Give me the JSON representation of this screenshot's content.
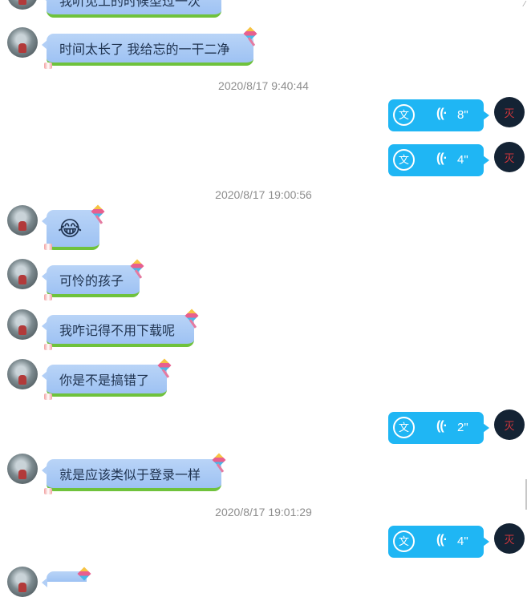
{
  "messages": {
    "m1_text": "我听见工的时候型过一次",
    "m2_text": "时间太长了 我给忘的一干二净",
    "m4_emoji": "😂",
    "m5_text": "可怜的孩子",
    "m6_text": "我咋记得不用下载呢",
    "m7_text": "你是不是搞错了",
    "m8_text": "就是应该类似于登录一样"
  },
  "timestamps": {
    "t1": "2020/8/17 9:40:44",
    "t2": "2020/8/17 19:00:56",
    "t3": "2020/8/17 19:01:29"
  },
  "voice": {
    "translate_glyph": "文",
    "wave_glyph": "((·",
    "v1": "8\"",
    "v2": "4\"",
    "v3": "2\"",
    "v4": "4\""
  },
  "self_avatar_glyph": "灭",
  "colors": {
    "incoming_bubble": "#a9cbf5",
    "incoming_underline": "#6fc23c",
    "voice_bubble": "#1fb6f4",
    "timestamp_text": "#8d8d8d"
  }
}
